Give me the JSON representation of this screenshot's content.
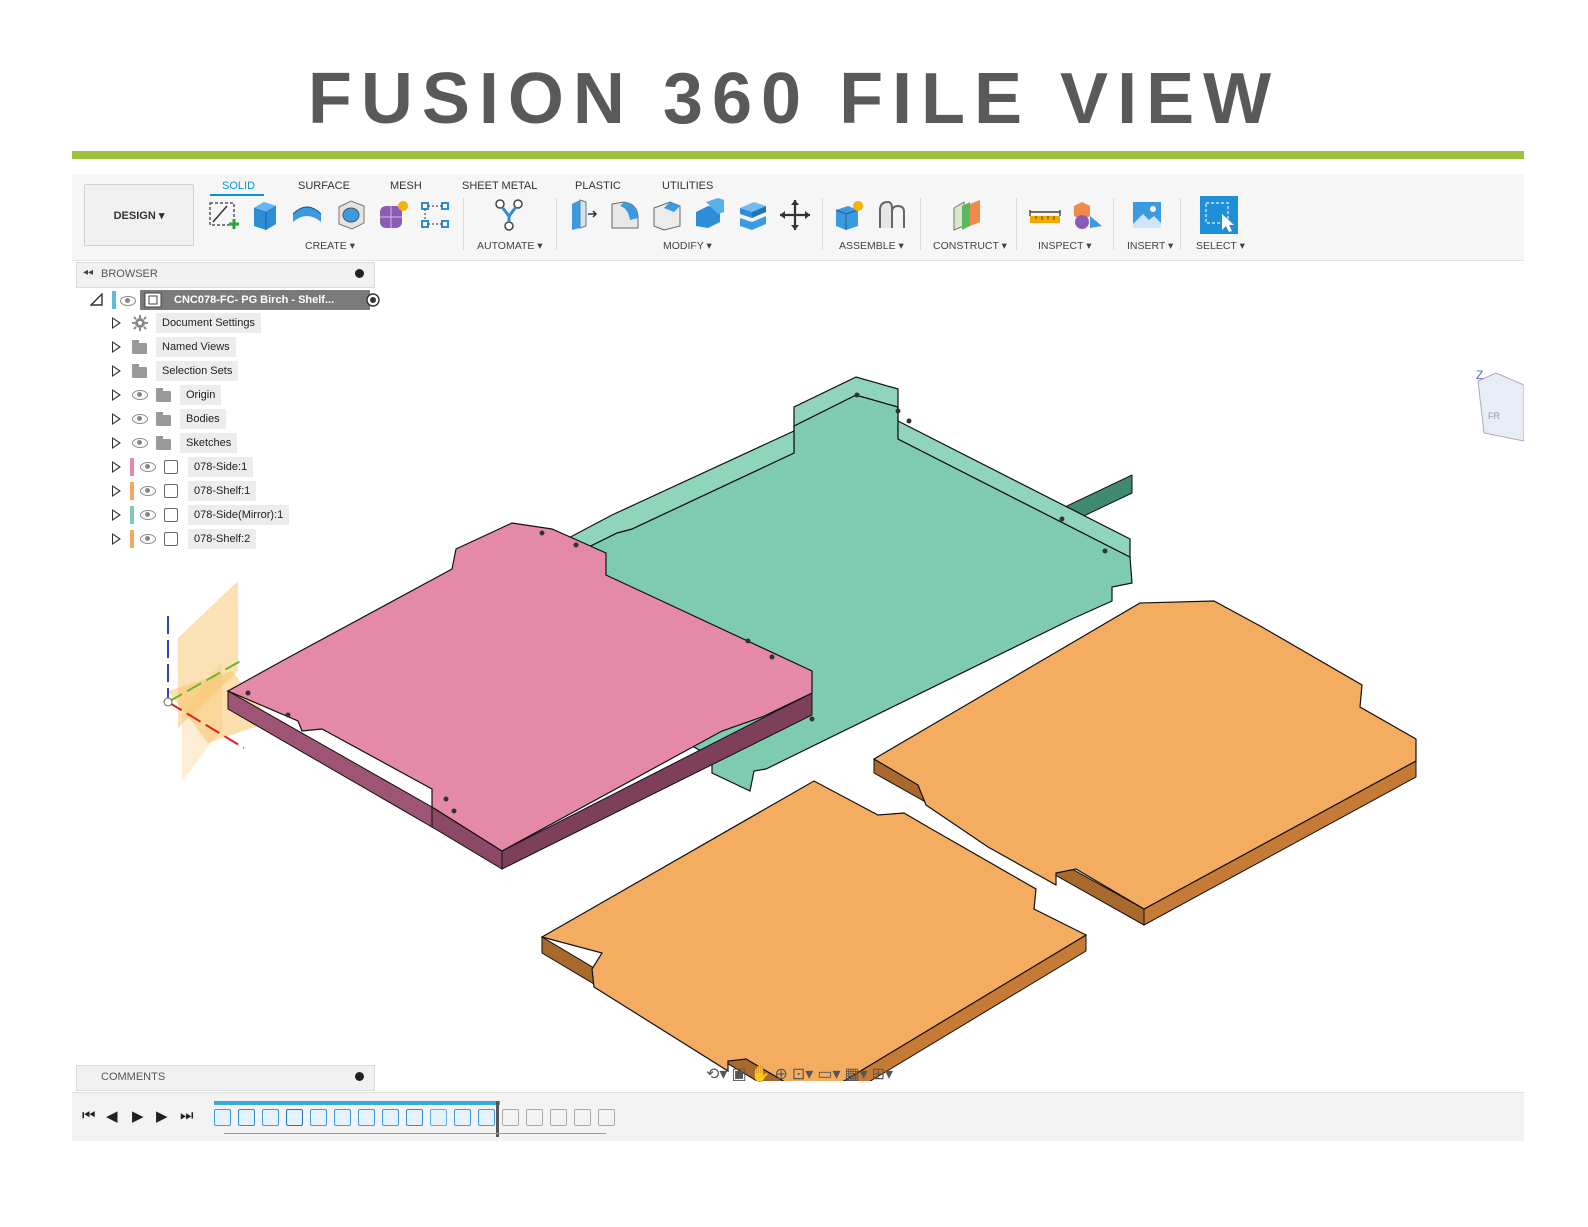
{
  "slide": {
    "title": "FUSION 360 FILE VIEW",
    "accent_color": "#9dc33c"
  },
  "toolbar": {
    "workspace": "DESIGN ▾",
    "tabs": [
      {
        "label": "SOLID",
        "active": true
      },
      {
        "label": "SURFACE",
        "active": false
      },
      {
        "label": "MESH",
        "active": false
      },
      {
        "label": "SHEET METAL",
        "active": false
      },
      {
        "label": "PLASTIC",
        "active": false
      },
      {
        "label": "UTILITIES",
        "active": false
      }
    ],
    "groups": [
      "CREATE ▾",
      "AUTOMATE ▾",
      "MODIFY ▾",
      "ASSEMBLE ▾",
      "CONSTRUCT ▾",
      "INSPECT ▾",
      "INSERT ▾",
      "SELECT ▾"
    ],
    "accent_color": "#0696d7"
  },
  "browser": {
    "title": "BROWSER",
    "root": "CNC078-FC-  PG Birch - Shelf...",
    "items": [
      {
        "label": "Document Settings",
        "icon": "gear-icon",
        "eye": false,
        "color": ""
      },
      {
        "label": "Named Views",
        "icon": "folder-icon",
        "eye": false,
        "color": ""
      },
      {
        "label": "Selection Sets",
        "icon": "folder-icon",
        "eye": false,
        "color": ""
      },
      {
        "label": "Origin",
        "icon": "folder-icon",
        "eye": true,
        "color": ""
      },
      {
        "label": "Bodies",
        "icon": "folder-icon",
        "eye": true,
        "color": ""
      },
      {
        "label": "Sketches",
        "icon": "folder-icon",
        "eye": true,
        "color": ""
      },
      {
        "label": "078-Side:1",
        "icon": "component-icon",
        "eye": true,
        "color": "#e487a8"
      },
      {
        "label": "078-Shelf:1",
        "icon": "component-icon",
        "eye": true,
        "color": "#f2a95f"
      },
      {
        "label": "078-Side(Mirror):1",
        "icon": "component-icon",
        "eye": true,
        "color": "#7dcbb0"
      },
      {
        "label": "078-Shelf:2",
        "icon": "component-icon",
        "eye": true,
        "color": "#f2a95f"
      }
    ]
  },
  "comments": {
    "title": "COMMENTS"
  },
  "viewcube": {
    "axis_label": "Z",
    "face_label": "FR"
  },
  "parts": {
    "colors": {
      "side": "#e589a9",
      "side_mirror": "#7fcbb1",
      "shelf": "#f4ac60"
    }
  }
}
